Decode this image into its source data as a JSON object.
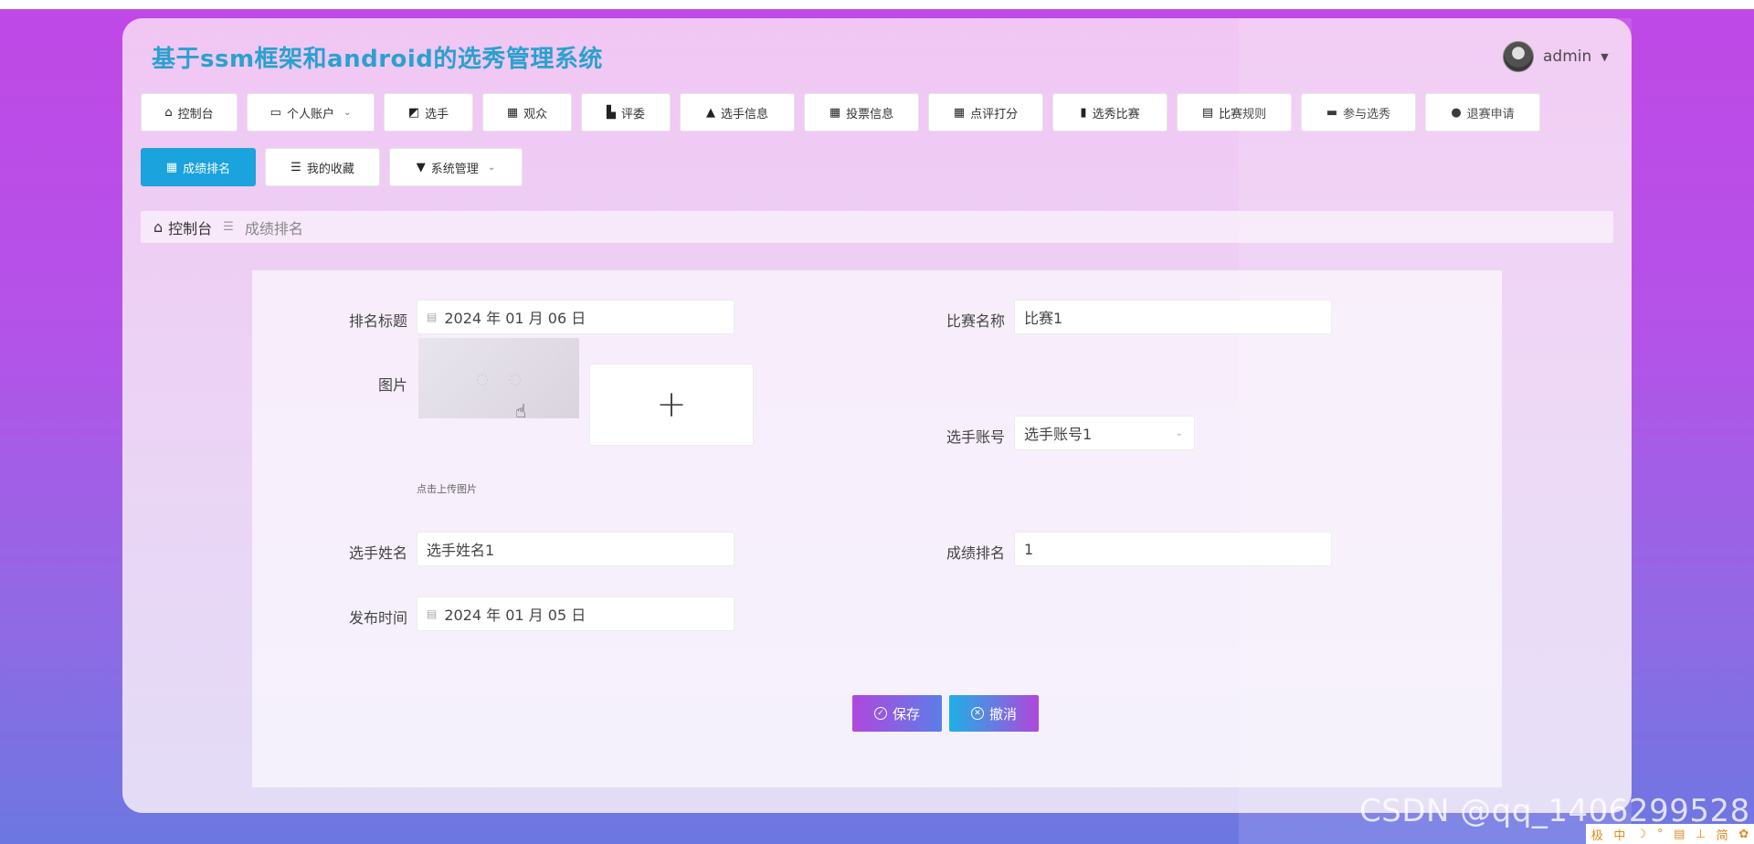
{
  "app": {
    "title": "基于ssm框架和android的选秀管理系统"
  },
  "user": {
    "name": "admin"
  },
  "nav": [
    {
      "label": "控制台",
      "icon": "home-icon",
      "glyph": "⌂"
    },
    {
      "label": "个人账户",
      "icon": "wallet-icon",
      "glyph": "▭",
      "dropdown": true
    },
    {
      "label": "选手",
      "icon": "chart-icon",
      "glyph": "◩"
    },
    {
      "label": "观众",
      "icon": "grid-icon",
      "glyph": "▦"
    },
    {
      "label": "评委",
      "icon": "judge-icon",
      "glyph": "▙"
    },
    {
      "label": "选手信息",
      "icon": "user-icon",
      "glyph": "▲"
    },
    {
      "label": "投票信息",
      "icon": "grid-icon",
      "glyph": "▦"
    },
    {
      "label": "点评打分",
      "icon": "apps-icon",
      "glyph": "▦"
    },
    {
      "label": "选秀比赛",
      "icon": "bar-chart-icon",
      "glyph": "▮"
    },
    {
      "label": "比赛规则",
      "icon": "briefcase-icon",
      "glyph": "▤"
    },
    {
      "label": "参与选秀",
      "icon": "monitor-icon",
      "glyph": "▬"
    },
    {
      "label": "退赛申请",
      "icon": "location-icon",
      "glyph": "●"
    },
    {
      "label": "成绩排名",
      "icon": "grid-icon",
      "glyph": "▦",
      "active": true
    },
    {
      "label": "我的收藏",
      "icon": "sliders-icon",
      "glyph": "☰"
    },
    {
      "label": "系统管理",
      "icon": "brush-icon",
      "glyph": "▼",
      "dropdown": true
    }
  ],
  "breadcrumb": {
    "home": "控制台",
    "current": "成绩排名"
  },
  "form": {
    "ranking_title_label": "排名标题",
    "ranking_title_value": "2024 年 01 月 06 日",
    "competition_name_label": "比赛名称",
    "competition_name_value": "比赛1",
    "image_label": "图片",
    "upload_hint": "点击上传图片",
    "player_account_label": "选手账号",
    "player_account_value": "选手账号1",
    "player_name_label": "选手姓名",
    "player_name_value": "选手姓名1",
    "rank_label": "成绩排名",
    "rank_value": "1",
    "publish_time_label": "发布时间",
    "publish_time_value": "2024 年 01 月 05 日"
  },
  "buttons": {
    "save": "保存",
    "cancel": "撤消"
  },
  "watermark": "CSDN @qq_1406299528",
  "ime_bar": [
    "极",
    "中",
    "☽",
    "°",
    "▤",
    "⊥",
    "简",
    "✿"
  ]
}
